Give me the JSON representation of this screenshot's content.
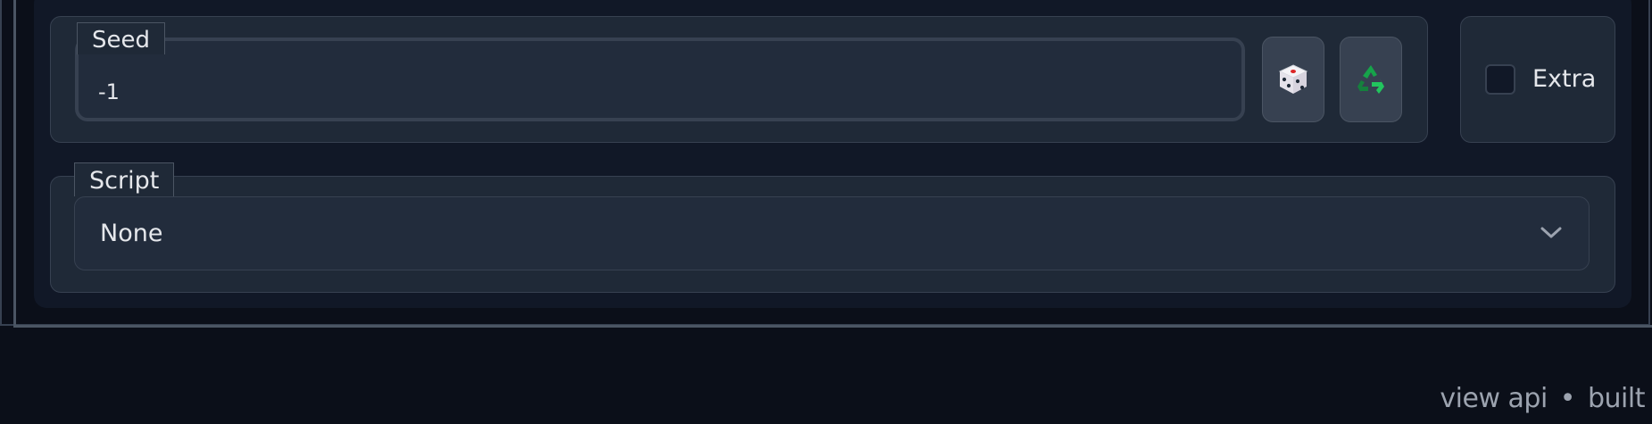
{
  "seed": {
    "label": "Seed",
    "value": "-1",
    "random_button_icon": "dice-icon",
    "reuse_button_icon": "recycle-icon"
  },
  "extra": {
    "label": "Extra",
    "checked": false
  },
  "script": {
    "label": "Script",
    "selected": "None"
  },
  "footer": {
    "view_api": "view api",
    "separator": "•",
    "built": "built"
  },
  "colors": {
    "background": "#0b0f19",
    "panel": "#1f2937",
    "input": "#222c3c",
    "border": "#374151",
    "text": "#e5e7eb",
    "muted": "#9ca3af",
    "recycle_green": "#16a34a"
  }
}
